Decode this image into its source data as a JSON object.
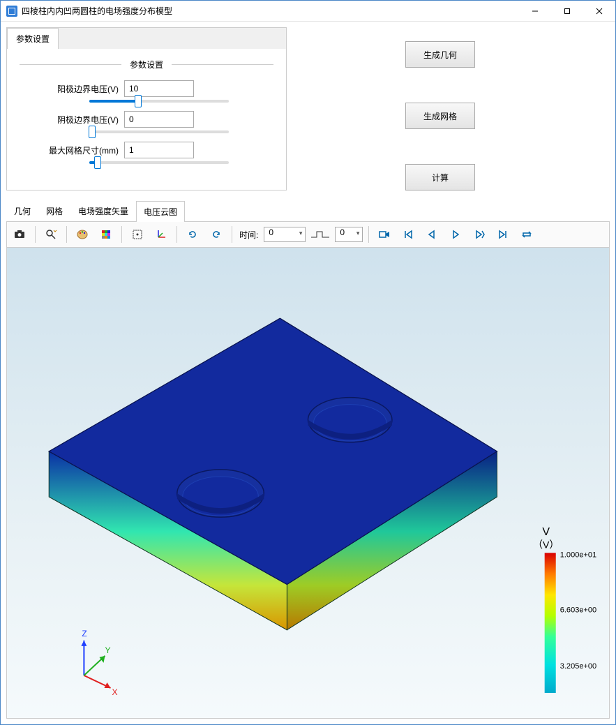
{
  "window": {
    "title": "四棱柱内内凹两圆柱的电场强度分布模型"
  },
  "paramTab": {
    "label": "参数设置"
  },
  "paramGroup": {
    "legend": "参数设置"
  },
  "params": {
    "anode": {
      "label": "阳极边界电压(V)",
      "value": "10",
      "slider_pct": 35
    },
    "cathode": {
      "label": "阴极边界电压(V)",
      "value": "0",
      "slider_pct": 2
    },
    "mesh": {
      "label": "最大网格尺寸(mm)",
      "value": "1",
      "slider_pct": 6
    }
  },
  "buttons": {
    "gen_geom": "生成几何",
    "gen_mesh": "生成网格",
    "compute": "计算"
  },
  "visTabs": {
    "geom": "几何",
    "mesh": "网格",
    "efield": "电场强度矢量",
    "vcloud": "电压云图"
  },
  "toolbar": {
    "time_label": "时间:",
    "time_value": "0",
    "step_value": "0"
  },
  "legend": {
    "title1": "V",
    "title2": "（V）",
    "max": "1.000e+01",
    "mid": "6.603e+00",
    "low": "3.205e+00"
  },
  "axes": {
    "x": "X",
    "y": "Y",
    "z": "Z"
  }
}
